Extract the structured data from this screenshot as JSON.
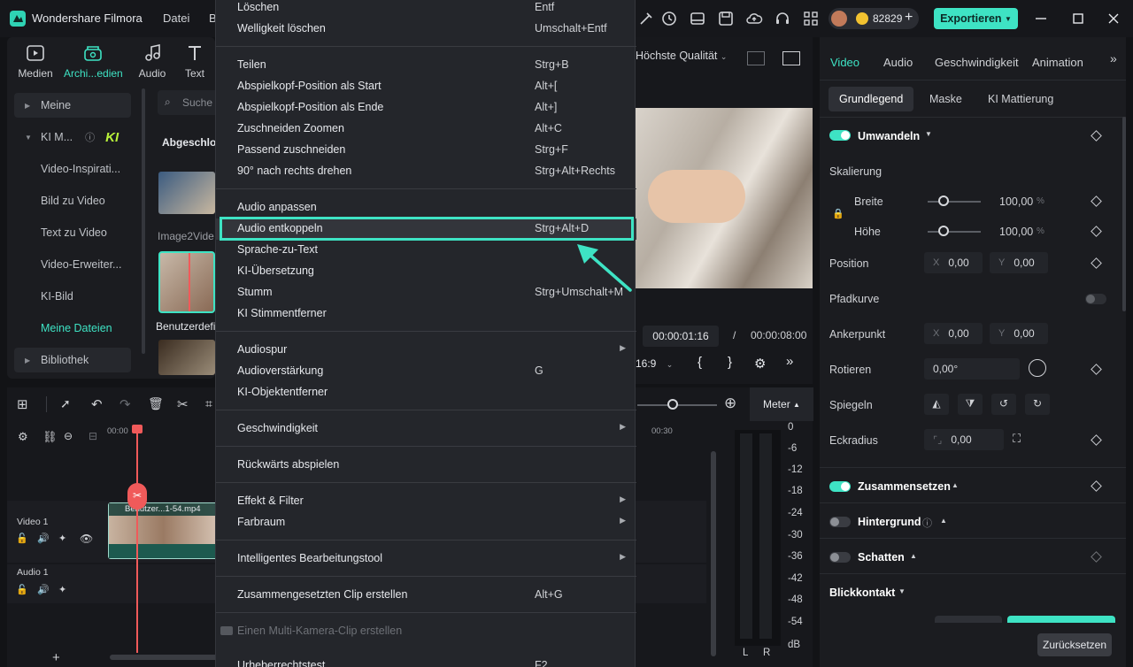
{
  "titlebar": {
    "app_title": "Wondershare Filmora",
    "menu": [
      "Datei",
      "B"
    ],
    "credits": "82829",
    "export_label": "Exportieren"
  },
  "media_tabs": [
    {
      "label": "Medien",
      "icon": "media-icon"
    },
    {
      "label": "Archi...edien",
      "icon": "archive-media-icon"
    },
    {
      "label": "Audio",
      "icon": "music-note-icon"
    },
    {
      "label": "Text",
      "icon": "text-icon"
    }
  ],
  "sidebar": {
    "items": [
      "Meine",
      "KI M...",
      "Video-Inspirati...",
      "Bild zu Video",
      "Text zu Video",
      "Video-Erweiter...",
      "KI-Bild",
      "Meine Dateien",
      "Bibliothek"
    ],
    "ki_badge": "KI",
    "search_placeholder": "Suche",
    "section_title": "Abgeschlos",
    "thumb1_label": "Image2Vide",
    "thumb2_label": "Benutzerdefi"
  },
  "context_menu": {
    "items": [
      {
        "label": "Löschen",
        "shortcut": "Entf"
      },
      {
        "label": "Welligkeit löschen",
        "shortcut": "Umschalt+Entf"
      },
      {
        "label": "Teilen",
        "shortcut": "Strg+B"
      },
      {
        "label": "Abspielkopf-Position als Start",
        "shortcut": "Alt+["
      },
      {
        "label": "Abspielkopf-Position als Ende",
        "shortcut": "Alt+]"
      },
      {
        "label": "Zuschneiden  Zoomen",
        "shortcut": "Alt+C"
      },
      {
        "label": "Passend zuschneiden",
        "shortcut": "Strg+F"
      },
      {
        "label": "90° nach rechts drehen",
        "shortcut": "Strg+Alt+Rechts"
      },
      {
        "label": "Audio anpassen",
        "shortcut": ""
      },
      {
        "label": "Audio entkoppeln",
        "shortcut": "Strg+Alt+D"
      },
      {
        "label": "Sprache-zu-Text",
        "shortcut": ""
      },
      {
        "label": "KI-Übersetzung",
        "shortcut": ""
      },
      {
        "label": "Stumm",
        "shortcut": "Strg+Umschalt+M"
      },
      {
        "label": "KI Stimmentferner",
        "shortcut": ""
      },
      {
        "label": "Audiospur",
        "shortcut": ""
      },
      {
        "label": "Audioverstärkung",
        "shortcut": "G"
      },
      {
        "label": "KI-Objektentferner",
        "shortcut": ""
      },
      {
        "label": "Geschwindigkeit",
        "shortcut": ""
      },
      {
        "label": "Rückwärts abspielen",
        "shortcut": ""
      },
      {
        "label": "Effekt & Filter",
        "shortcut": ""
      },
      {
        "label": "Farbraum",
        "shortcut": ""
      },
      {
        "label": "Intelligentes Bearbeitungstool",
        "shortcut": ""
      },
      {
        "label": "Zusammengesetzten Clip erstellen",
        "shortcut": "Alt+G"
      },
      {
        "label": "Einen Multi-Kamera-Clip erstellen",
        "shortcut": ""
      },
      {
        "label": "Urheberrechtstest",
        "shortcut": "F2"
      }
    ]
  },
  "preview": {
    "quality": "Höchste Qualität",
    "current_time": "00:00:01:16",
    "separator": "/",
    "total_time": "00:00:08:00",
    "aspect": "16:9",
    "bracket_in": "{",
    "bracket_out": "}"
  },
  "timeline": {
    "ruler_start": "00:00",
    "ruler_mark": "00:30",
    "video_track": "Video 1",
    "audio_track": "Audio 1",
    "clip_label": "Benutzer...1-54.mp4",
    "meter_button": "Meter",
    "meter_scale": [
      "0",
      "-6",
      "-12",
      "-18",
      "-24",
      "-30",
      "-36",
      "-42",
      "-48",
      "-54",
      "dB"
    ],
    "meter_channels": [
      "L",
      "R"
    ],
    "add_track": "+"
  },
  "right_panel": {
    "tabs": [
      "Video",
      "Audio",
      "Geschwindigkeit",
      "Animation"
    ],
    "subtabs": [
      "Grundlegend",
      "Maske",
      "KI Mattierung"
    ],
    "umwandeln": "Umwandeln",
    "skalierung": "Skalierung",
    "breite": "Breite",
    "breite_value": "100,00",
    "hoehe": "Höhe",
    "hoehe_value": "100,00",
    "percent": "%",
    "position": "Position",
    "pos_x": "0,00",
    "pos_y": "0,00",
    "axis_x": "X",
    "axis_y": "Y",
    "pfadkurve": "Pfadkurve",
    "ankerpunkt": "Ankerpunkt",
    "anchor_x": "0,00",
    "anchor_y": "0,00",
    "rotieren": "Rotieren",
    "rotation": "0,00°",
    "spiegeln": "Spiegeln",
    "eckradius": "Eckradius",
    "eckradius_value": "0,00",
    "zusammensetzen": "Zusammensetzen",
    "hintergrund": "Hintergrund",
    "schatten": "Schatten",
    "blickkontakt": "Blickkontakt",
    "reset": "Zurücksetzen"
  },
  "colors": {
    "accent": "#3ee3c4",
    "menu_bg": "#24262b",
    "panel_bg": "#1b1c20"
  }
}
